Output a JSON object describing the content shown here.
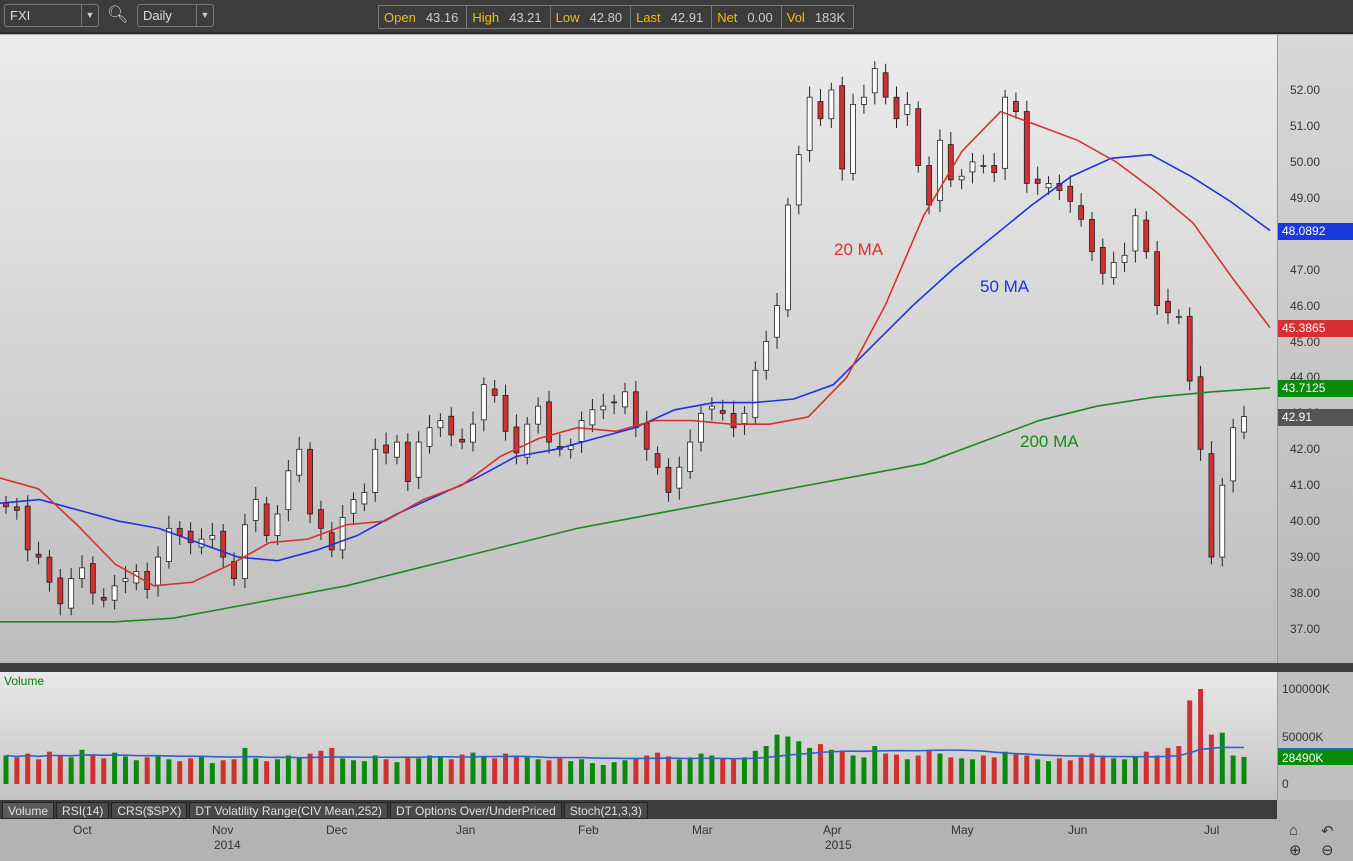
{
  "toolbar": {
    "symbol": "FXI",
    "interval": "Daily",
    "quote": [
      {
        "k": "Open",
        "v": "43.16"
      },
      {
        "k": "High",
        "v": "43.21"
      },
      {
        "k": "Low",
        "v": "42.80"
      },
      {
        "k": "Last",
        "v": "42.91"
      },
      {
        "k": "Net",
        "v": "0.00"
      },
      {
        "k": "Vol",
        "v": "183K"
      }
    ]
  },
  "tabs": [
    "Volume",
    "RSI(14)",
    "CRS($SPX)",
    "DT Volatility Range(CIV Mean,252)",
    "DT Options Over/UnderPriced",
    "Stoch(21,3,3)"
  ],
  "volume_label": "Volume",
  "colors": {
    "up": "#ffffff",
    "down": "#d03030",
    "ma20": "#d83030",
    "ma50": "#2030e0",
    "ma200": "#1a8a1a",
    "vol_up": "#0a8a0a",
    "vol_down": "#d03030"
  },
  "chart_data": {
    "type": "candlestick",
    "yticks": [
      "52.00",
      "51.00",
      "50.00",
      "49.00",
      "48.00",
      "47.00",
      "46.00",
      "45.00",
      "44.00",
      "43.00",
      "42.00",
      "41.00",
      "40.00",
      "39.00",
      "38.00",
      "37.00"
    ],
    "ylim": [
      36.0,
      53.5
    ],
    "months": [
      {
        "label": "Oct",
        "year": ""
      },
      {
        "label": "Nov",
        "year": "2014"
      },
      {
        "label": "Dec",
        "year": ""
      },
      {
        "label": "Jan",
        "year": ""
      },
      {
        "label": "Feb",
        "year": ""
      },
      {
        "label": "Mar",
        "year": ""
      },
      {
        "label": "Apr",
        "year": "2015"
      },
      {
        "label": "May",
        "year": ""
      },
      {
        "label": "Jun",
        "year": ""
      },
      {
        "label": "Jul",
        "year": ""
      }
    ],
    "closes": [
      40.4,
      40.3,
      39.2,
      39.0,
      38.3,
      37.7,
      38.4,
      38.7,
      38.0,
      37.8,
      38.2,
      38.4,
      38.6,
      38.1,
      39.0,
      39.8,
      39.6,
      39.4,
      39.5,
      39.6,
      39.0,
      38.4,
      39.9,
      40.6,
      39.6,
      40.2,
      41.4,
      42.0,
      40.2,
      39.8,
      39.2,
      40.1,
      40.6,
      40.8,
      42.0,
      41.9,
      42.2,
      41.1,
      42.2,
      42.6,
      42.8,
      42.4,
      42.2,
      42.7,
      43.8,
      43.5,
      42.5,
      41.9,
      42.7,
      43.2,
      42.2,
      42.0,
      42.1,
      42.8,
      43.1,
      43.2,
      43.3,
      43.6,
      42.6,
      42.0,
      41.5,
      40.8,
      41.5,
      42.2,
      43.0,
      43.2,
      43.0,
      42.6,
      43.0,
      44.2,
      45.0,
      46.0,
      48.8,
      50.2,
      51.8,
      51.2,
      52.0,
      49.8,
      51.6,
      51.8,
      52.6,
      51.8,
      51.2,
      51.6,
      49.9,
      48.8,
      50.6,
      49.5,
      49.6,
      50.0,
      49.9,
      49.7,
      51.8,
      51.4,
      49.4,
      49.4,
      49.4,
      49.2,
      48.9,
      48.4,
      47.5,
      46.9,
      47.2,
      47.4,
      48.5,
      47.5,
      46.0,
      45.8,
      45.7,
      43.9,
      42.0,
      39.0,
      41.0,
      42.6,
      42.91
    ],
    "volumes_k": [
      30000,
      28000,
      32000,
      26000,
      34000,
      30000,
      28000,
      36000,
      31000,
      27000,
      33000,
      29000,
      25000,
      28000,
      30000,
      26000,
      24000,
      27000,
      29000,
      22000,
      25000,
      26000,
      38000,
      27000,
      24000,
      26000,
      30000,
      28000,
      32000,
      35000,
      38000,
      27000,
      25000,
      24000,
      30000,
      26000,
      23000,
      29000,
      27000,
      30000,
      28000,
      26000,
      31000,
      33000,
      29000,
      27000,
      32000,
      30000,
      28000,
      26000,
      25000,
      27000,
      24000,
      26000,
      22000,
      20000,
      23000,
      25000,
      27000,
      30000,
      33000,
      29000,
      26000,
      28000,
      32000,
      30000,
      27000,
      26000,
      28000,
      35000,
      40000,
      52000,
      50000,
      45000,
      38000,
      42000,
      36000,
      34000,
      30000,
      28000,
      40000,
      32000,
      31000,
      26000,
      30000,
      36000,
      32000,
      28000,
      27000,
      26000,
      30000,
      28000,
      34000,
      31000,
      30000,
      26000,
      24000,
      27000,
      25000,
      28000,
      32000,
      30000,
      27000,
      26000,
      29000,
      34000,
      30000,
      38000,
      40000,
      88000,
      100000,
      52000,
      54000,
      30000,
      28490
    ],
    "ma20": [
      41.2,
      40.9,
      39.9,
      38.8,
      38.2,
      38.3,
      38.8,
      39.4,
      39.5,
      39.9,
      40.0,
      40.6,
      41.0,
      41.8,
      42.3,
      42.6,
      42.5,
      42.8,
      42.8,
      42.7,
      42.7,
      42.9,
      44.0,
      46.0,
      48.5,
      50.3,
      51.4,
      51.0,
      50.6,
      50.0,
      49.2,
      48.3,
      46.8,
      45.3865
    ],
    "ma50": [
      40.5,
      40.6,
      40.3,
      40.0,
      39.8,
      39.4,
      39.0,
      38.9,
      39.2,
      39.6,
      40.2,
      40.7,
      41.2,
      41.8,
      42.0,
      42.3,
      42.6,
      43.1,
      43.3,
      43.3,
      43.4,
      43.8,
      44.9,
      46.0,
      47.0,
      47.9,
      48.8,
      49.6,
      50.1,
      50.2,
      49.6,
      48.9,
      48.0892
    ],
    "ma200": [
      37.2,
      37.2,
      37.2,
      37.3,
      37.6,
      37.9,
      38.2,
      38.6,
      39.0,
      39.4,
      39.8,
      40.1,
      40.4,
      40.7,
      41.0,
      41.3,
      41.6,
      42.2,
      42.8,
      43.2,
      43.45,
      43.6,
      43.7125
    ],
    "ma_labels": {
      "ma20": "20 MA",
      "ma50": "50 MA",
      "ma200": "200 MA"
    },
    "badges": {
      "ma50": "48.0892",
      "ma20": "45.3865",
      "ma200": "43.7125",
      "last": "42.91"
    },
    "volume_axis": [
      "100000K",
      "50000K",
      "0"
    ],
    "volume_badge": "28490K"
  }
}
